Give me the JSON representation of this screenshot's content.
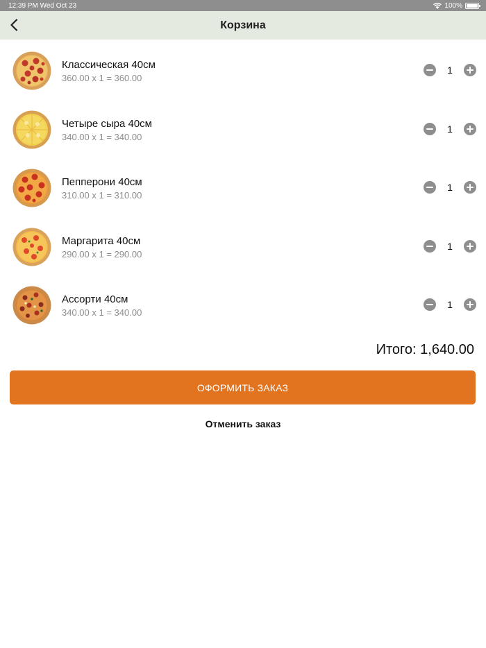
{
  "status_bar": {
    "time": "12:39 PM  Wed Oct 23",
    "battery": "100%"
  },
  "nav": {
    "title": "Корзина"
  },
  "cart": {
    "items": [
      {
        "name": "Классическая 40см",
        "price_line": "360.00 x 1 = 360.00",
        "quantity": "1"
      },
      {
        "name": "Четыре сыра 40см",
        "price_line": "340.00 x 1 = 340.00",
        "quantity": "1"
      },
      {
        "name": "Пепперони 40см",
        "price_line": "310.00 x 1 = 310.00",
        "quantity": "1"
      },
      {
        "name": "Маргарита 40см",
        "price_line": "290.00 x 1 = 290.00",
        "quantity": "1"
      },
      {
        "name": "Ассорти 40см",
        "price_line": "340.00 x 1 = 340.00",
        "quantity": "1"
      }
    ],
    "total": "Итого: 1,640.00"
  },
  "actions": {
    "checkout_label": "ОФОРМИТЬ ЗАКАЗ",
    "cancel_label": "Отменить заказ"
  },
  "colors": {
    "accent": "#e2731f",
    "nav_bg": "#e4eae0",
    "muted_text": "#8c8c8c",
    "qty_button": "#8e8e8e"
  }
}
